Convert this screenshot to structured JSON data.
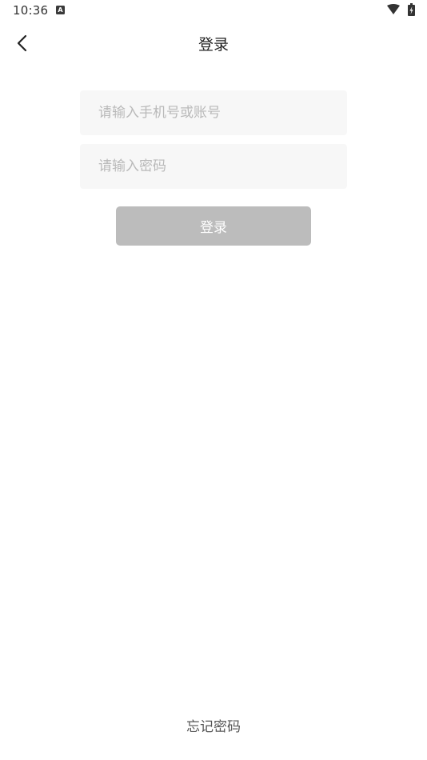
{
  "status_bar": {
    "time": "10:36",
    "notification_icon_letter": "A",
    "icons": [
      "notification-icon",
      "wifi-icon",
      "battery-icon"
    ]
  },
  "header": {
    "back_icon": "chevron-left-icon",
    "title": "登录"
  },
  "form": {
    "account": {
      "placeholder": "请输入手机号或账号",
      "value": ""
    },
    "password": {
      "placeholder": "请输入密码",
      "value": ""
    },
    "login_button_label": "登录"
  },
  "footer": {
    "forgot_password_label": "忘记密码"
  },
  "colors": {
    "field_background": "#f7f7f7",
    "button_disabled": "#bcbcbc",
    "placeholder": "#b9b9b9"
  }
}
